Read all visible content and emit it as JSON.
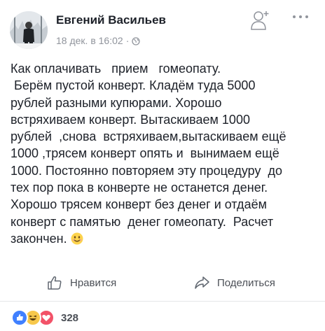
{
  "post": {
    "author_name": "Евгений Васильев",
    "timestamp": "18 дек. в 16:02",
    "separator": "·",
    "privacy_icon": "globe-icon",
    "body_lines": [
      "Как оплачивать   прием   гомеопату.",
      " Берём пустой конверт. Кладём туда 5000",
      "рублей разными купюрами. Хорошо",
      "встряхиваем конверт. Вытаскиваем 1000",
      "рублей  ,снова  встряхиваем,вытаскиваем ещё",
      "1000 ,трясем конверт опять и  вынимаем ещё",
      "1000. Постоянно повторяем эту процедуру  до",
      "тех пор пока в конверте не останется денег.",
      "Хорошо трясем конверт без денег и отдаём",
      "конверт с памятью  денег гомеопату.  Расчет",
      "закончен. "
    ],
    "end_emoji": "smile-emoji"
  },
  "actions": {
    "like_label": "Нравится",
    "share_label": "Поделиться"
  },
  "reactions": {
    "icons": [
      "like-reaction-icon",
      "haha-reaction-icon",
      "love-reaction-icon"
    ],
    "count": "328"
  },
  "colors": {
    "text": "#1d2129",
    "meta": "#90949c",
    "like_blue": "#4080ff",
    "haha_yellow": "#f7c84b",
    "love_red": "#f25268"
  }
}
